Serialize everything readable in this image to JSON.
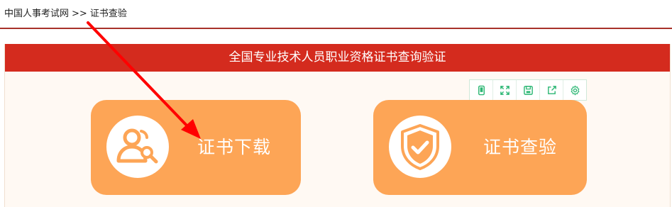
{
  "breadcrumb": {
    "home": "中国人事考试网",
    "separator": ">>",
    "current": "证书查验"
  },
  "panel": {
    "title": "全国专业技术人员职业资格证书查询验证"
  },
  "toolbar": {
    "icons": [
      "mobile-icon",
      "fullscreen-icon",
      "save-icon",
      "share-icon",
      "settings-icon"
    ]
  },
  "cards": {
    "download": {
      "label": "证书下载",
      "icon": "user-search-icon"
    },
    "verify": {
      "label": "证书查验",
      "icon": "shield-check-icon"
    }
  },
  "colors": {
    "header_red": "#d42b1e",
    "rule": "#a8322a",
    "card_orange": "#fda556",
    "panel_bg": "#fff9f3",
    "toolbar_green": "#2bb673",
    "annotation_arrow": "#ff0000"
  }
}
